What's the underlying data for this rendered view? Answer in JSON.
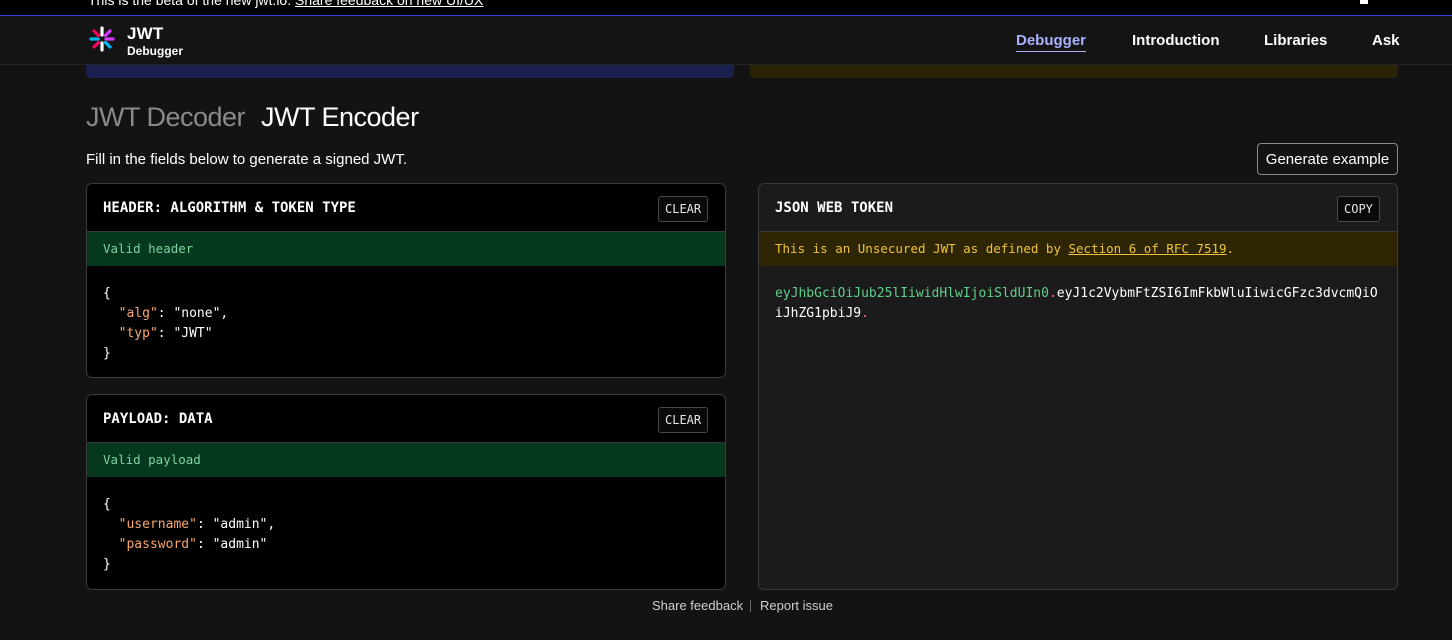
{
  "banner": {
    "text": "This is the beta of the new jwt.io.",
    "link": "Share feedback on new UI/UX"
  },
  "nav": {
    "brand_title": "JWT",
    "brand_subtitle": "Debugger",
    "links": [
      {
        "label": "Debugger",
        "active": true
      },
      {
        "label": "Introduction",
        "active": false
      },
      {
        "label": "Libraries",
        "active": false
      },
      {
        "label": "Ask",
        "active": false
      }
    ]
  },
  "modes": {
    "decoder": "JWT Decoder",
    "encoder": "JWT Encoder",
    "active": "encoder"
  },
  "instructions": "Fill in the fields below to generate a signed JWT.",
  "generate_button": "Generate example",
  "header_card": {
    "title": "HEADER: ALGORITHM & TOKEN TYPE",
    "clear_label": "CLEAR",
    "status": "Valid header",
    "json": {
      "open": "{",
      "lines": [
        {
          "key": "\"alg\"",
          "value": "\"none\"",
          "comma": ","
        },
        {
          "key": "\"typ\"",
          "value": "\"JWT\"",
          "comma": ""
        }
      ],
      "close": "}"
    }
  },
  "payload_card": {
    "title": "PAYLOAD: DATA",
    "clear_label": "CLEAR",
    "status": "Valid payload",
    "json": {
      "open": "{",
      "lines": [
        {
          "key": "\"username\"",
          "value": "\"admin\"",
          "comma": ","
        },
        {
          "key": "\"password\"",
          "value": "\"admin\"",
          "comma": ""
        }
      ],
      "close": "}"
    }
  },
  "token_card": {
    "title": "JSON WEB TOKEN",
    "copy_label": "COPY",
    "warning_prefix": "This is an Unsecured JWT as defined by ",
    "warning_link": "Section 6 of RFC 7519",
    "warning_suffix": ".",
    "token_header": "eyJhbGciOiJub25lIiwidHlwIjoiSldUIn0",
    "token_payload": "eyJ1c2VybmFtZSI6ImFkbWluIiwicGFzc3dvcmQiOiJhZG1pbiJ9",
    "dot": "."
  },
  "footer": {
    "share": "Share feedback",
    "report": "Report issue"
  },
  "colors": {
    "background": "#131313",
    "accent": "#a9b1ff",
    "valid_bg": "#063820",
    "warn_bg": "#2e2505",
    "json_key": "#f7a76c"
  }
}
